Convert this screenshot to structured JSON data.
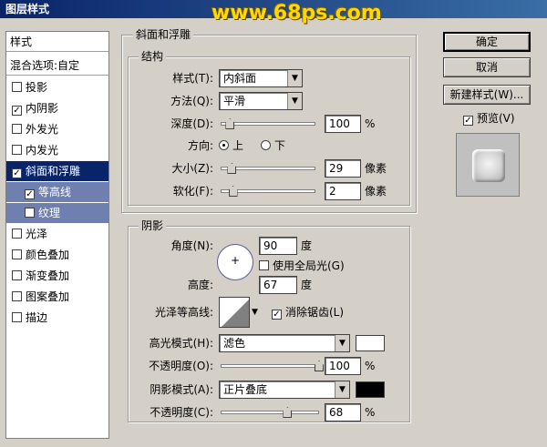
{
  "window": {
    "title": "图层样式",
    "watermark": "www.68ps.com"
  },
  "style_list": {
    "header": "样式",
    "blend_options": "混合选项:自定",
    "items": [
      {
        "label": "投影",
        "checked": false
      },
      {
        "label": "内阴影",
        "checked": true
      },
      {
        "label": "外发光",
        "checked": false
      },
      {
        "label": "内发光",
        "checked": false
      },
      {
        "label": "斜面和浮雕",
        "checked": true,
        "selected": true
      },
      {
        "label": "等高线",
        "checked": true,
        "sub": true
      },
      {
        "label": "纹理",
        "checked": false,
        "sub": true
      },
      {
        "label": "光泽",
        "checked": false
      },
      {
        "label": "颜色叠加",
        "checked": false
      },
      {
        "label": "渐变叠加",
        "checked": false
      },
      {
        "label": "图案叠加",
        "checked": false
      },
      {
        "label": "描边",
        "checked": false
      }
    ]
  },
  "bevel": {
    "group_title": "斜面和浮雕",
    "structure_title": "结构",
    "style_label": "样式(T):",
    "style_value": "内斜面",
    "method_label": "方法(Q):",
    "method_value": "平滑",
    "depth_label": "深度(D):",
    "depth_value": "100",
    "depth_fraction": 0.1,
    "depth_unit": "%",
    "direction_label": "方向:",
    "direction_up": "上",
    "direction_down": "下",
    "size_label": "大小(Z):",
    "size_value": "29",
    "size_fraction": 0.12,
    "size_unit": "像素",
    "soften_label": "软化(F):",
    "soften_value": "2",
    "soften_fraction": 0.13,
    "soften_unit": "像素"
  },
  "shading": {
    "title": "阴影",
    "angle_label": "角度(N):",
    "angle_value": "90",
    "angle_unit": "度",
    "global_light_label": "使用全局光(G)",
    "altitude_label": "高度:",
    "altitude_value": "67",
    "altitude_unit": "度",
    "gloss_contour_label": "光泽等高线:",
    "anti_alias_label": "消除锯齿(L)",
    "highlight_mode_label": "高光模式(H):",
    "highlight_mode_value": "滤色",
    "highlight_color": "#ffffff",
    "highlight_opacity_label": "不透明度(O):",
    "highlight_opacity_value": "100",
    "highlight_opacity_fraction": 1.0,
    "highlight_opacity_unit": "%",
    "shadow_mode_label": "阴影模式(A):",
    "shadow_mode_value": "正片叠底",
    "shadow_color": "#000000",
    "shadow_opacity_label": "不透明度(C):",
    "shadow_opacity_value": "68",
    "shadow_opacity_fraction": 0.68,
    "shadow_opacity_unit": "%"
  },
  "buttons": {
    "ok": "确定",
    "cancel": "取消",
    "new_style": "新建样式(W)...",
    "preview": "预览(V)"
  }
}
